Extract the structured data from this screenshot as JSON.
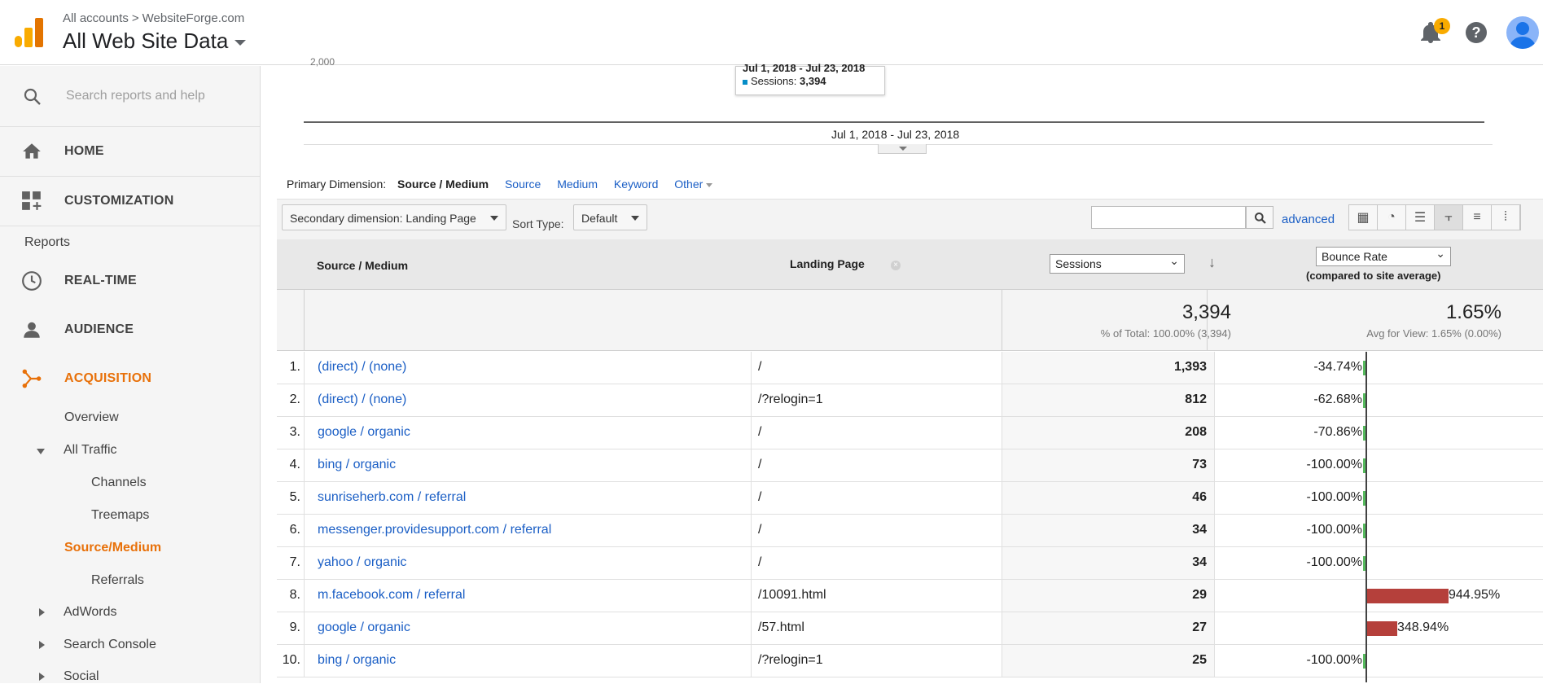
{
  "header": {
    "breadcrumb_all": "All accounts",
    "breadcrumb_sep": ">",
    "breadcrumb_account": "WebsiteForge.com",
    "property": "All Web Site Data",
    "notification_count": "1",
    "help": "?"
  },
  "sidebar": {
    "search_placeholder": "Search reports and help",
    "home": "HOME",
    "customization": "CUSTOMIZATION",
    "reports": "Reports",
    "realtime": "REAL-TIME",
    "audience": "AUDIENCE",
    "acquisition": "ACQUISITION",
    "overview": "Overview",
    "all_traffic": "All Traffic",
    "channels": "Channels",
    "treemaps": "Treemaps",
    "source_medium": "Source/Medium",
    "referrals": "Referrals",
    "adwords": "AdWords",
    "search_console": "Search Console",
    "social": "Social"
  },
  "chart": {
    "y_tick": "2,000",
    "tooltip_date": "Jul 1, 2018 - Jul 23, 2018",
    "tooltip_metric": "Sessions:",
    "tooltip_value": "3,394",
    "x_label": "Jul 1, 2018 - Jul 23, 2018"
  },
  "dimension_bar": {
    "label": "Primary Dimension:",
    "current": "Source / Medium",
    "options": [
      "Source",
      "Medium",
      "Keyword",
      "Other"
    ]
  },
  "toolbar": {
    "secondary": "Secondary dimension: Landing Page",
    "sort_type_label": "Sort Type:",
    "sort_type": "Default",
    "search_value": "",
    "advanced": "advanced"
  },
  "table": {
    "col_source": "Source / Medium",
    "col_landing": "Landing Page",
    "metric1": "Sessions",
    "metric2": "Bounce Rate",
    "compare": "(compared to site average)",
    "total_sessions": "3,394",
    "total_sessions_sub": "% of Total: 100.00% (3,394)",
    "total_bounce": "1.65%",
    "total_bounce_sub": "Avg for View: 1.65% (0.00%)",
    "rows": [
      {
        "n": "1.",
        "src": "(direct) / (none)",
        "lp": "/",
        "sess": "1,393",
        "br": "-34.74%",
        "brv": -34.74
      },
      {
        "n": "2.",
        "src": "(direct) / (none)",
        "lp": "/?relogin=1",
        "sess": "812",
        "br": "-62.68%",
        "brv": -62.68
      },
      {
        "n": "3.",
        "src": "google / organic",
        "lp": "/",
        "sess": "208",
        "br": "-70.86%",
        "brv": -70.86
      },
      {
        "n": "4.",
        "src": "bing / organic",
        "lp": "/",
        "sess": "73",
        "br": "-100.00%",
        "brv": -100
      },
      {
        "n": "5.",
        "src": "sunriseherb.com / referral",
        "lp": "/",
        "sess": "46",
        "br": "-100.00%",
        "brv": -100
      },
      {
        "n": "6.",
        "src": "messenger.providesupport.com / referral",
        "lp": "/",
        "sess": "34",
        "br": "-100.00%",
        "brv": -100
      },
      {
        "n": "7.",
        "src": "yahoo / organic",
        "lp": "/",
        "sess": "34",
        "br": "-100.00%",
        "brv": -100
      },
      {
        "n": "8.",
        "src": "m.facebook.com / referral",
        "lp": "/10091.html",
        "sess": "29",
        "br": "944.95%",
        "brv": 944.95
      },
      {
        "n": "9.",
        "src": "google / organic",
        "lp": "/57.html",
        "sess": "27",
        "br": "348.94%",
        "brv": 348.94
      },
      {
        "n": "10.",
        "src": "bing / organic",
        "lp": "/?relogin=1",
        "sess": "25",
        "br": "-100.00%",
        "brv": -100
      }
    ]
  },
  "colors": {
    "accent": "#e8710a",
    "link": "#1a5ec5",
    "positive": "#57bb5e",
    "negative": "#b5403b"
  }
}
